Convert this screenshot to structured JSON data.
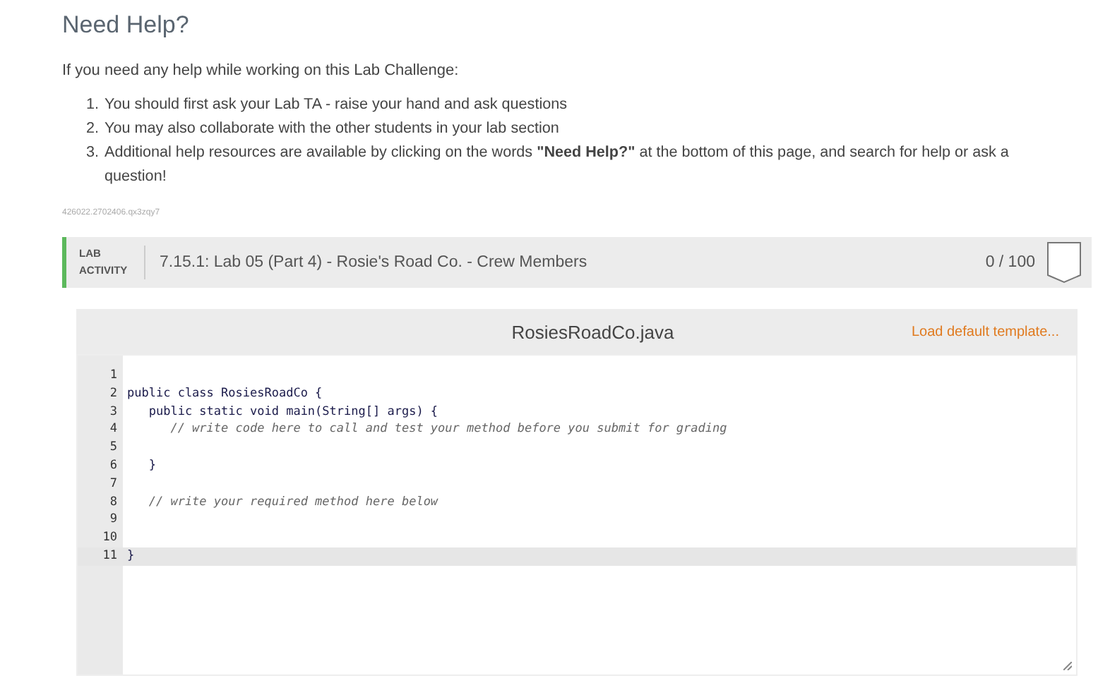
{
  "help": {
    "title": "Need Help?",
    "intro": "If you need any help while working on this Lab Challenge:",
    "items": [
      {
        "marker": "1.",
        "text": "You should first ask your Lab TA - raise your hand and ask questions"
      },
      {
        "marker": "2.",
        "text": "You may also collaborate with the other students in your lab section"
      },
      {
        "marker": "3.",
        "text": "Additional help resources are available by clicking on the words **\"Need Help?\"** at the bottom of this page, and search for help or ask a question!"
      }
    ],
    "id_code": "426022.2702406.qx3zqy7"
  },
  "lab": {
    "label": "LAB ACTIVITY",
    "title": "7.15.1: Lab 05 (Part 4) - Rosie's Road Co. - Crew Members",
    "score": "0 / 100"
  },
  "editor": {
    "filename": "RosiesRoadCo.java",
    "template_link": "Load default template...",
    "lines": [
      {
        "number": "1",
        "active": false
      },
      {
        "number": "2",
        "text": "public class RosiesRoadCo {",
        "kind": "code",
        "active": false
      },
      {
        "number": "3",
        "text": "   public static void main(String[] args) {",
        "kind": "code",
        "active": false
      },
      {
        "number": "4",
        "text": "      // write code here to call and test your method before you submit for grading",
        "kind": "comment",
        "active": false
      },
      {
        "number": "5",
        "active": false
      },
      {
        "number": "6",
        "text": "   }",
        "kind": "code",
        "active": false
      },
      {
        "number": "7",
        "active": false
      },
      {
        "number": "8",
        "text": "   // write your required method here below",
        "kind": "comment",
        "active": false
      },
      {
        "number": "9",
        "active": false
      },
      {
        "number": "10",
        "active": false
      },
      {
        "number": "11",
        "text": "}",
        "kind": "code",
        "active": true
      }
    ]
  }
}
